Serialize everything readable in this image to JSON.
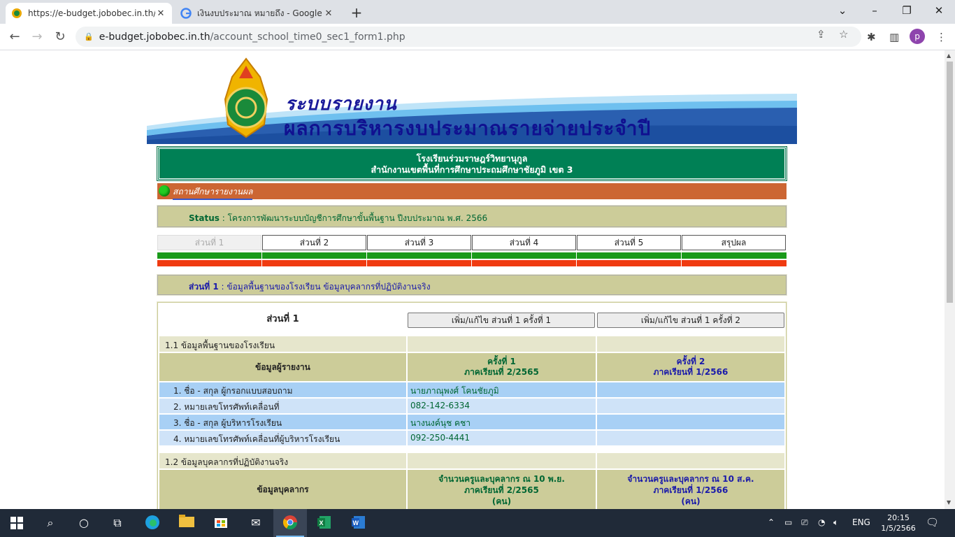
{
  "browser": {
    "tabs": [
      {
        "title": "https://e-budget.jobobec.in.th/ac",
        "active": true
      },
      {
        "title": "เงินงบประมาณ หมายถึง - Google Se",
        "active": false
      }
    ],
    "url_host": "e-budget.jobobec.in.th",
    "url_path": "/account_school_time0_sec1_form1.php",
    "profile_initial": "p"
  },
  "banner": {
    "line1": "ระบบรายงาน",
    "line2": "ผลการบริหารงบประมาณรายจ่ายประจำปี"
  },
  "school": {
    "name": "โรงเรียนร่วมราษฎร์วิทยานุกูล",
    "office": "สำนักงานเขตพื้นที่การศึกษาประถมศึกษาชัยภูมิ เขต 3"
  },
  "section_bar": {
    "label": "สถานศึกษารายงานผล"
  },
  "status": {
    "label": "Status",
    "text": " : โครงการพัฒนาระบบบัญชีการศึกษาขั้นพื้นฐาน ปีงบประมาณ พ.ศ. 2566"
  },
  "section_tabs": [
    "ส่วนที่ 1",
    "ส่วนที่ 2",
    "ส่วนที่ 3",
    "ส่วนที่ 4",
    "ส่วนที่ 5",
    "สรุปผล"
  ],
  "part": {
    "label": "ส่วนที่ 1",
    "text": " : ข้อมูลพื้นฐานของโรงเรียน ข้อมูลบุคลากรที่ปฏิบัติงานจริง"
  },
  "form": {
    "title": "ส่วนที่ 1",
    "edit_button_1": "เพิ่ม/แก้ไข ส่วนที่ 1 ครั้งที่ 1",
    "edit_button_2": "เพิ่ม/แก้ไข ส่วนที่ 1 ครั้งที่ 2",
    "s1_title": "1.1 ข้อมูลพื้นฐานของโรงเรียน",
    "reporter_header": "ข้อมูลผู้รายงาน",
    "round1_line1": "ครั้งที่ 1",
    "round1_line2": "ภาคเรียนที่ 2/2565",
    "round2_line1": "ครั้งที่ 2",
    "round2_line2": "ภาคเรียนที่ 1/2566",
    "reporter_rows": [
      {
        "label": "1. ชื่อ - สกุล ผู้กรอกแบบสอบถาม",
        "v1": "นายภาณุพงศ์ โคนชัยภูมิ",
        "v2": ""
      },
      {
        "label": "2. หมายเลขโทรศัพท์เคลื่อนที่",
        "v1": "082-142-6334",
        "v2": ""
      },
      {
        "label": "3. ชื่อ - สกุล ผู้บริหารโรงเรียน",
        "v1": "นางนงค์นุช คชา",
        "v2": ""
      },
      {
        "label": "4. หมายเลขโทรศัพท์เคลื่อนที่ผู้บริหารโรงเรียน",
        "v1": "092-250-4441",
        "v2": ""
      }
    ],
    "s2_title": "1.2 ข้อมูลบุคลากรที่ปฏิบัติงานจริง",
    "personnel_header": "ข้อมูลบุคลากร",
    "p1_line1": "จำนวนครูและบุคลากร ณ 10 พ.ย.",
    "p1_line2": "ภาคเรียนที่ 2/2565",
    "p1_line3": "(คน)",
    "p2_line1": "จำนวนครูและบุคลากร ณ 10 ส.ค.",
    "p2_line2": "ภาคเรียนที่ 1/2566",
    "p2_line3": "(คน)"
  },
  "taskbar": {
    "language": "ENG",
    "time": "20:15",
    "date": "1/5/2566"
  },
  "colors": {
    "school_green": "#008055",
    "section_orange": "#cc6633",
    "khaki": "#cccc99",
    "tab_green": "#1a9a1a",
    "tab_red": "#f03a10"
  }
}
